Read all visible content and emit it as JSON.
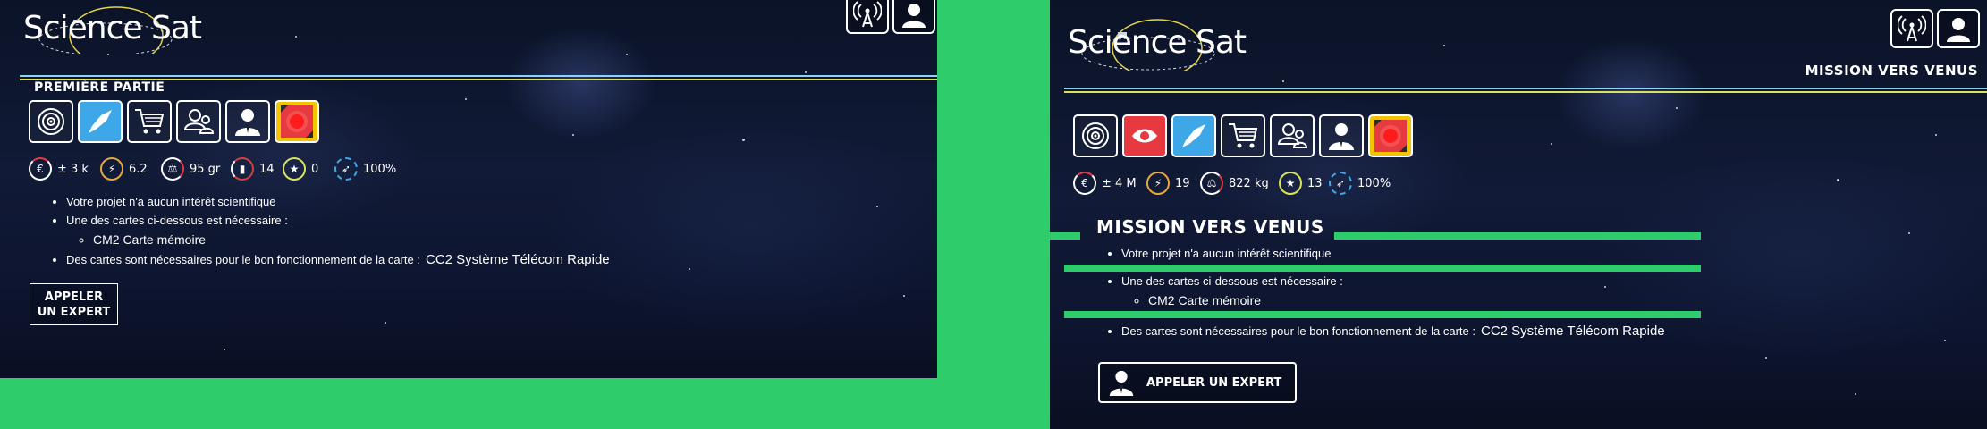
{
  "colors": {
    "accent_green": "#2ecc6b",
    "blue_card": "#3da7e8",
    "red_card": "#e63a40",
    "alert_card": "#f3c400"
  },
  "logo": {
    "text": "Science Sat"
  },
  "left_panel": {
    "section_title": "Première partie",
    "cards": [
      {
        "icon": "target-icon"
      },
      {
        "icon": "rocket-icon",
        "selected": true
      },
      {
        "icon": "cart-icon"
      },
      {
        "icon": "team-icon"
      },
      {
        "icon": "user-icon"
      },
      {
        "icon": "alert-icon"
      }
    ],
    "stats": [
      {
        "icon": "euro-icon",
        "value": "± 3 k"
      },
      {
        "icon": "lightning-icon",
        "value": "6.2"
      },
      {
        "icon": "weight-icon",
        "value": "95 gr"
      },
      {
        "icon": "size-icon",
        "value": "14"
      },
      {
        "icon": "star-icon",
        "value": "0"
      },
      {
        "icon": "rocket-icon",
        "value": "100%"
      }
    ],
    "requirements": {
      "line1": "Votre projet n'a aucun intérêt scientifique",
      "line2": "Une des cartes ci-dessous est nécessaire :",
      "sub1": "CM2 Carte mémoire",
      "line3": "Des cartes sont nécessaires pour le bon fonctionnement de la carte :",
      "card3": "CC2 Système Télécom Rapide"
    },
    "expert_button": "Appeler un expert"
  },
  "right_panel": {
    "mission_header": "Mission vers Venus",
    "cards": [
      {
        "icon": "target-icon"
      },
      {
        "icon": "eye-icon",
        "selected": true
      },
      {
        "icon": "rocket-icon"
      },
      {
        "icon": "cart-icon"
      },
      {
        "icon": "team-icon"
      },
      {
        "icon": "user-icon"
      },
      {
        "icon": "alert-icon"
      }
    ],
    "stats": [
      {
        "icon": "euro-icon",
        "value": "± 4 M"
      },
      {
        "icon": "lightning-icon",
        "value": "19"
      },
      {
        "icon": "weight-icon",
        "value": "822 kg"
      },
      {
        "icon": "star-icon",
        "value": "13"
      },
      {
        "icon": "rocket-icon",
        "value": "100%"
      }
    ],
    "section_title": "Mission vers Venus",
    "requirements": {
      "line1": "Votre projet n'a aucun intérêt scientifique",
      "line2": "Une des cartes ci-dessous est nécessaire :",
      "sub1": "CM2 Carte mémoire",
      "line3": "Des cartes sont nécessaires pour le bon fonctionnement de la carte :",
      "card3": "CC2 Système Télécom Rapide"
    },
    "expert_button": "Appeler un expert"
  }
}
